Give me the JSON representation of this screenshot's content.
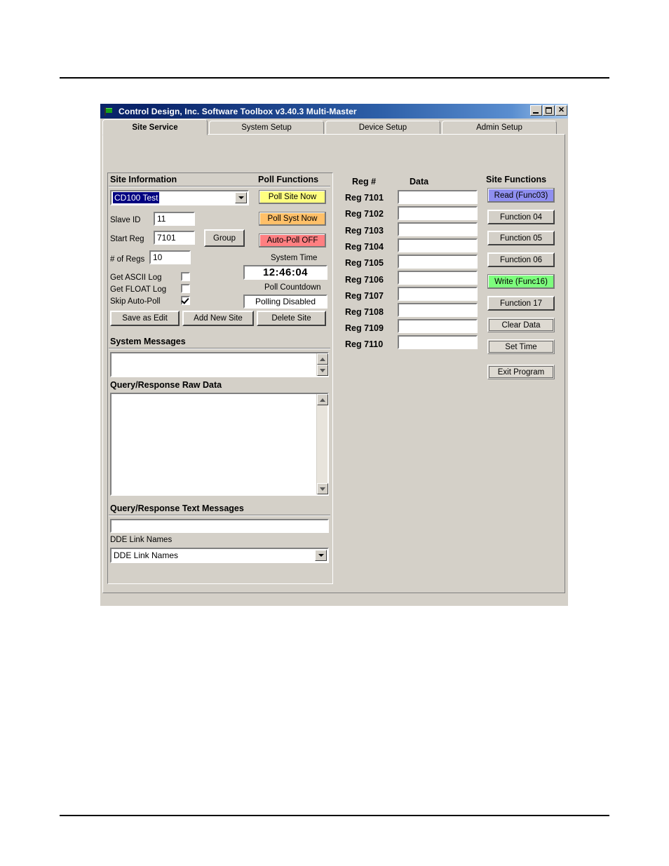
{
  "window": {
    "title": "Control Design, Inc.   Software Toolbox   v3.40.3 Multi-Master",
    "icon": "flag-icon",
    "controls": {
      "minimize": "_",
      "maximize": "□",
      "close": "✕"
    }
  },
  "tabs": [
    {
      "label": "Site Service",
      "active": true
    },
    {
      "label": "System Setup",
      "active": false
    },
    {
      "label": "Device Setup",
      "active": false
    },
    {
      "label": "Admin Setup",
      "active": false
    }
  ],
  "site_information": {
    "heading": "Site Information",
    "site_combo": {
      "value": "CD100 Test",
      "selected": true
    },
    "fields": [
      {
        "label": "Slave ID",
        "value": "11"
      },
      {
        "label": "Start Reg",
        "value": "7101"
      },
      {
        "label": "# of Regs",
        "value": "10"
      }
    ],
    "group_button": "Group",
    "checkboxes": [
      {
        "label": "Get ASCII Log",
        "checked": false
      },
      {
        "label": "Get FLOAT Log",
        "checked": false
      },
      {
        "label": "Skip Auto-Poll",
        "checked": true
      }
    ],
    "buttons": [
      {
        "label": "Save as Edit"
      },
      {
        "label": "Add New Site"
      },
      {
        "label": "Delete Site"
      }
    ]
  },
  "poll_functions": {
    "heading": "Poll Functions",
    "buttons": [
      {
        "label": "Poll Site Now",
        "color": "#ffff80"
      },
      {
        "label": "Poll Syst Now",
        "color": "#ffc069"
      },
      {
        "label": "Auto-Poll OFF",
        "color": "#ff7f81"
      }
    ],
    "system_time": {
      "label": "System Time",
      "value": "12:46:04"
    },
    "poll_countdown": {
      "label": "Poll Countdown",
      "value": "Polling Disabled"
    }
  },
  "messages": {
    "system_messages_label": "System Messages",
    "system_messages_value": "",
    "raw_data_label": "Query/Response Raw Data",
    "raw_data_value": "",
    "text_messages_label": "Query/Response Text Messages",
    "text_messages_value": "",
    "dde_label": "DDE Link Names",
    "dde_value": "DDE Link Names"
  },
  "registers": {
    "col_reg": "Reg #",
    "col_data": "Data",
    "rows": [
      {
        "reg": "Reg 7101",
        "data": ""
      },
      {
        "reg": "Reg 7102",
        "data": ""
      },
      {
        "reg": "Reg 7103",
        "data": ""
      },
      {
        "reg": "Reg 7104",
        "data": ""
      },
      {
        "reg": "Reg 7105",
        "data": ""
      },
      {
        "reg": "Reg 7106",
        "data": ""
      },
      {
        "reg": "Reg 7107",
        "data": ""
      },
      {
        "reg": "Reg 7108",
        "data": ""
      },
      {
        "reg": "Reg 7109",
        "data": ""
      },
      {
        "reg": "Reg 7110",
        "data": ""
      }
    ]
  },
  "site_functions": {
    "heading": "Site Functions",
    "buttons": [
      {
        "label": "Read (Func03)",
        "color": "#8f8ff0"
      },
      {
        "label": "Function 04",
        "color": "#d4d0c8"
      },
      {
        "label": "Function 05",
        "color": "#d4d0c8"
      },
      {
        "label": "Function 06",
        "color": "#d4d0c8"
      },
      {
        "label": "Write (Func16)",
        "color": "#7dfd7d"
      },
      {
        "label": "Function 17",
        "color": "#d4d0c8"
      },
      {
        "label": "Clear Data",
        "color": "#dedad2"
      },
      {
        "label": "Set Time",
        "color": "#dedad2"
      },
      {
        "label": "Exit Program",
        "color": "#dedad2"
      }
    ]
  }
}
